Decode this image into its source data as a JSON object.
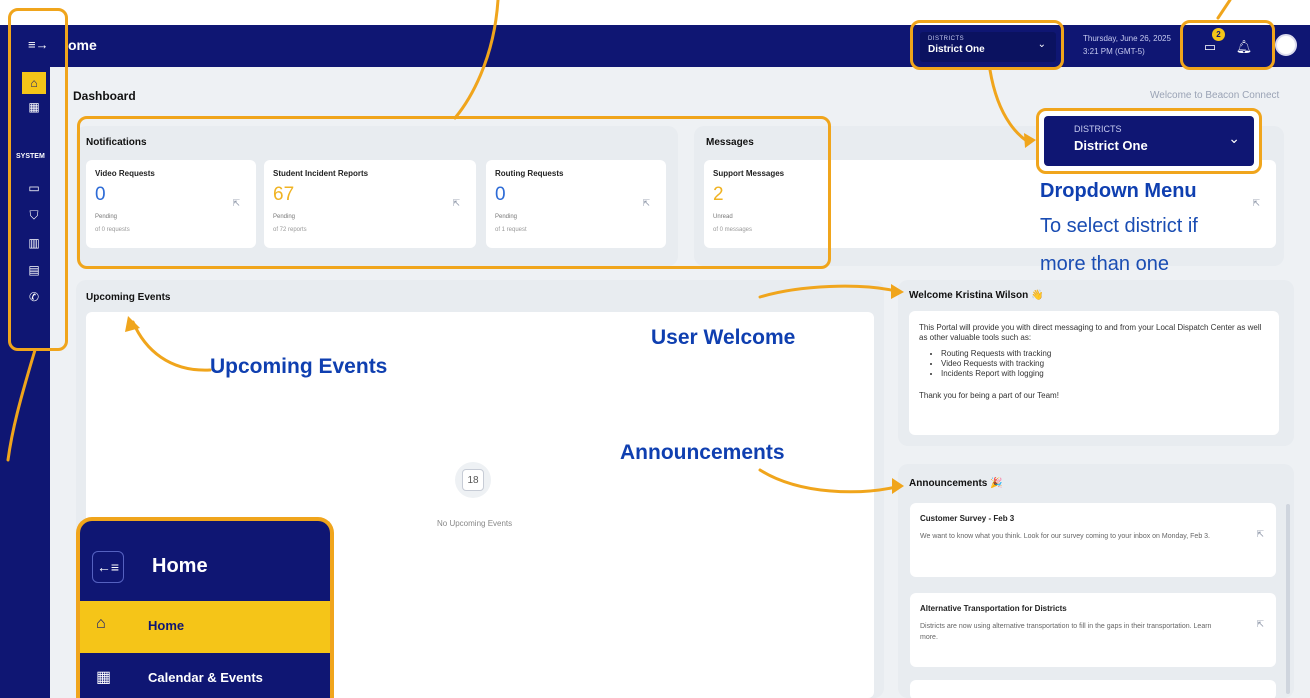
{
  "header": {
    "menu_icon": "sidebar-toggle-icon",
    "title": "ome",
    "district_select": {
      "label": "DISTRICTS",
      "value": "District One"
    },
    "date": "Thursday, June 26, 2025",
    "time": "3:21 PM (GMT-5)",
    "messages_badge": "2",
    "colors": {
      "navy": "#0f1673",
      "accent": "#f5c518",
      "callout": "#f0a51c"
    }
  },
  "sidebar": {
    "system_heading": "SYSTEM",
    "icons": [
      "home-icon",
      "calendar-icon",
      "video-icon",
      "shield-icon",
      "map-icon",
      "messages-icon",
      "phone-icon"
    ]
  },
  "page": {
    "title": "Dashboard",
    "welcome": "Welcome to Beacon Connect"
  },
  "notifications": {
    "title": "Notifications",
    "cards": [
      {
        "title": "Video Requests",
        "value": "0",
        "status": "Pending",
        "sub": "of 0 requests"
      },
      {
        "title": "Student Incident Reports",
        "value": "67",
        "status": "Pending",
        "sub": "of 72 reports"
      },
      {
        "title": "Routing Requests",
        "value": "0",
        "status": "Pending",
        "sub": "of 1 request"
      }
    ]
  },
  "messages": {
    "title": "Messages",
    "card": {
      "title": "Support Messages",
      "value": "2",
      "status": "Unread",
      "sub": "of 0 messages"
    }
  },
  "events": {
    "title": "Upcoming Events",
    "calendar_day": "18",
    "empty_text": "No Upcoming Events"
  },
  "user_welcome": {
    "title": "Welcome Kristina Wilson",
    "intro": "This Portal will provide you with direct messaging to and from your Local Dispatch Center as well as other valuable tools such as:",
    "bullets": [
      "Routing Requests with tracking",
      "Video Requests with tracking",
      "Incidents Report with logging"
    ],
    "closing": "Thank you for being a part of our Team!"
  },
  "announcements": {
    "title": "Announcements",
    "items": [
      {
        "title": "Customer Survey - Feb 3",
        "desc": "We want to know what you think. Look for our survey coming to your inbox on Monday, Feb 3."
      },
      {
        "title": "Alternative Transportation for Districts",
        "desc": "Districts are now using alternative transportation to fill in the gaps in their transportation. Learn more."
      }
    ]
  },
  "dropdown_zoom": {
    "label": "DISTRICTS",
    "value": "District One"
  },
  "annotations": {
    "dropdown_title": "Dropdown Menu",
    "dropdown_desc_1": "To select district if",
    "dropdown_desc_2": "more than one",
    "user_welcome": "User Welcome",
    "upcoming_events": "Upcoming Events",
    "announcements": "Announcements"
  },
  "inset": {
    "title": "Home",
    "items": [
      {
        "label": "Home",
        "icon": "home-icon"
      },
      {
        "label": "Calendar & Events",
        "icon": "calendar-icon"
      }
    ]
  }
}
